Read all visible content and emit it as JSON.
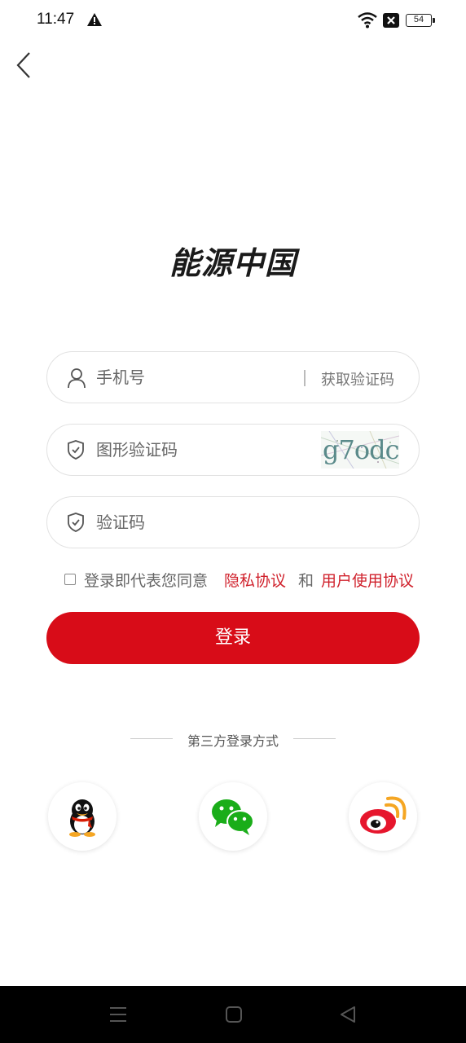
{
  "status_bar": {
    "time": "11:47",
    "battery": "54",
    "icons": [
      "warning-icon",
      "wifi-icon",
      "no-sim-icon",
      "battery-icon"
    ]
  },
  "header": {
    "back_icon": "chevron-left-icon"
  },
  "logo": {
    "text": "能源中国"
  },
  "form": {
    "phone": {
      "placeholder": "手机号",
      "icon": "user-icon",
      "get_code_label": "获取验证码"
    },
    "captcha": {
      "placeholder": "图形验证码",
      "icon": "shield-check-icon",
      "image_text": "g7odc"
    },
    "sms_code": {
      "placeholder": "验证码",
      "icon": "shield-check-icon"
    },
    "agreement": {
      "prefix": "登录即代表您同意",
      "privacy_link": "隐私协议",
      "and": "和",
      "user_link": "用户使用协议",
      "checked": false
    },
    "login_label": "登录"
  },
  "third_party": {
    "title": "第三方登录方式",
    "providers": [
      "qq-icon",
      "wechat-icon",
      "weibo-icon"
    ]
  },
  "colors": {
    "accent": "#d80c18",
    "link": "#d0212c",
    "border": "#e2e2e2"
  }
}
